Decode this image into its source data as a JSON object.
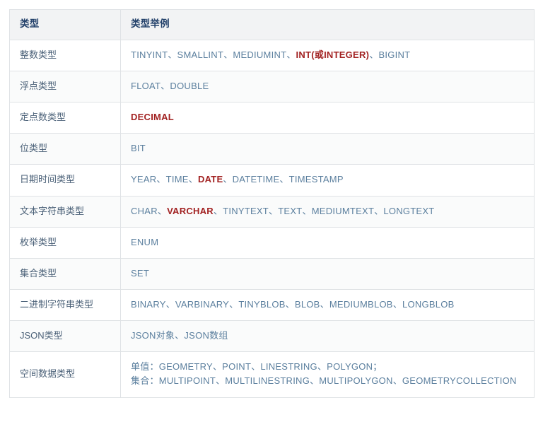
{
  "table": {
    "columns": [
      {
        "key": "type",
        "label": "类型"
      },
      {
        "key": "example",
        "label": "类型举例"
      }
    ],
    "rows": [
      {
        "type": "整数类型",
        "example_plain": "TINYINT、SMALLINT、MEDIUMINT、INT(或INTEGER)、BIGINT",
        "segments": [
          {
            "text": "TINYINT、SMALLINT、MEDIUMINT、",
            "highlight": false
          },
          {
            "text": "INT(或INTEGER)",
            "highlight": true
          },
          {
            "text": "、BIGINT",
            "highlight": false
          }
        ]
      },
      {
        "type": "浮点类型",
        "example_plain": "FLOAT、DOUBLE",
        "segments": [
          {
            "text": "FLOAT、DOUBLE",
            "highlight": false
          }
        ]
      },
      {
        "type": "定点数类型",
        "example_plain": "DECIMAL",
        "segments": [
          {
            "text": "DECIMAL",
            "highlight": true
          }
        ]
      },
      {
        "type": "位类型",
        "example_plain": "BIT",
        "segments": [
          {
            "text": "BIT",
            "highlight": false
          }
        ]
      },
      {
        "type": "日期时间类型",
        "example_plain": "YEAR、TIME、DATE、DATETIME、TIMESTAMP",
        "segments": [
          {
            "text": "YEAR、TIME、",
            "highlight": false
          },
          {
            "text": "DATE",
            "highlight": true
          },
          {
            "text": "、DATETIME、TIMESTAMP",
            "highlight": false
          }
        ]
      },
      {
        "type": "文本字符串类型",
        "example_plain": "CHAR、VARCHAR、TINYTEXT、TEXT、MEDIUMTEXT、LONGTEXT",
        "segments": [
          {
            "text": "CHAR、",
            "highlight": false
          },
          {
            "text": "VARCHAR",
            "highlight": true
          },
          {
            "text": "、TINYTEXT、TEXT、MEDIUMTEXT、LONGTEXT",
            "highlight": false
          }
        ]
      },
      {
        "type": "枚举类型",
        "example_plain": "ENUM",
        "segments": [
          {
            "text": "ENUM",
            "highlight": false
          }
        ]
      },
      {
        "type": "集合类型",
        "example_plain": "SET",
        "segments": [
          {
            "text": "SET",
            "highlight": false
          }
        ]
      },
      {
        "type": "二进制字符串类型",
        "example_plain": "BINARY、VARBINARY、TINYBLOB、BLOB、MEDIUMBLOB、LONGBLOB",
        "segments": [
          {
            "text": "BINARY、VARBINARY、TINYBLOB、BLOB、MEDIUMBLOB、LONGBLOB",
            "highlight": false
          }
        ]
      },
      {
        "type": "JSON类型",
        "example_plain": "JSON对象、JSON数组",
        "segments": [
          {
            "text": "JSON对象、JSON数组",
            "highlight": false
          }
        ]
      },
      {
        "type": "空间数据类型",
        "example_plain": "单值：GEOMETRY、POINT、LINESTRING、POLYGON；集合：MULTIPOINT、MULTILINESTRING、MULTIPOLYGON、GEOMETRYCOLLECTION",
        "lines": [
          "单值：GEOMETRY、POINT、LINESTRING、POLYGON；",
          "集合：MULTIPOINT、MULTILINESTRING、MULTIPOLYGON、GEOMETRYCOLLECTION"
        ]
      }
    ]
  },
  "colors": {
    "header_background": "#f2f3f4",
    "header_text": "#24426b",
    "border": "#dfe2e5",
    "type_text": "#4b6178",
    "example_text": "#5b7f9e",
    "highlight_text": "#a22222",
    "row_alt_background": "#fafbfb",
    "page_background": "#ffffff"
  }
}
